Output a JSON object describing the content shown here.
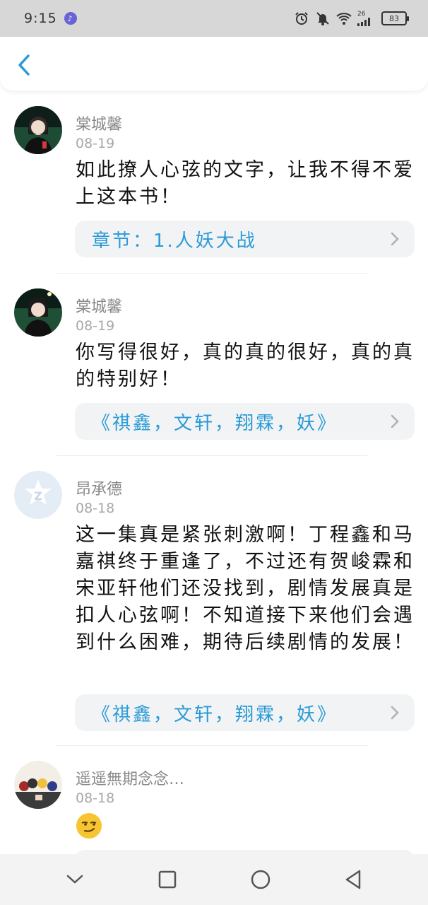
{
  "status_bar": {
    "time": "9:15",
    "network": "26",
    "battery": "83"
  },
  "comments": [
    {
      "username": "棠城馨",
      "date": "08-19",
      "text": "如此撩人心弦的文字，让我不得不爱上这本书！",
      "chapter": "章节：1.人妖大战"
    },
    {
      "username": "棠城馨",
      "date": "08-19",
      "text": "你写得很好，真的真的很好，真的真的特别好！",
      "chapter": "《祺鑫，文轩，翔霖，妖》"
    },
    {
      "username": "昂承德",
      "date": "08-18",
      "text": "这一集真是紧张刺激啊！丁程鑫和马嘉祺终于重逢了，不过还有贺峻霖和宋亚轩他们还没找到，剧情发展真是扣人心弦啊！不知道接下来他们会遇到什么困难，期待后续剧情的发展！",
      "chapter": "《祺鑫，文轩，翔霖，妖》"
    },
    {
      "username": "遥遥無期念念…",
      "date": "08-18",
      "emoji": "smirk-emoji"
    }
  ],
  "colors": {
    "accent": "#2a9ad6",
    "status_bar_bg": "#d7d7d7",
    "chapter_bg": "#f1f3f5"
  },
  "nav_icons": [
    "chevron-down-icon",
    "square-icon",
    "circle-icon",
    "triangle-back-icon"
  ]
}
